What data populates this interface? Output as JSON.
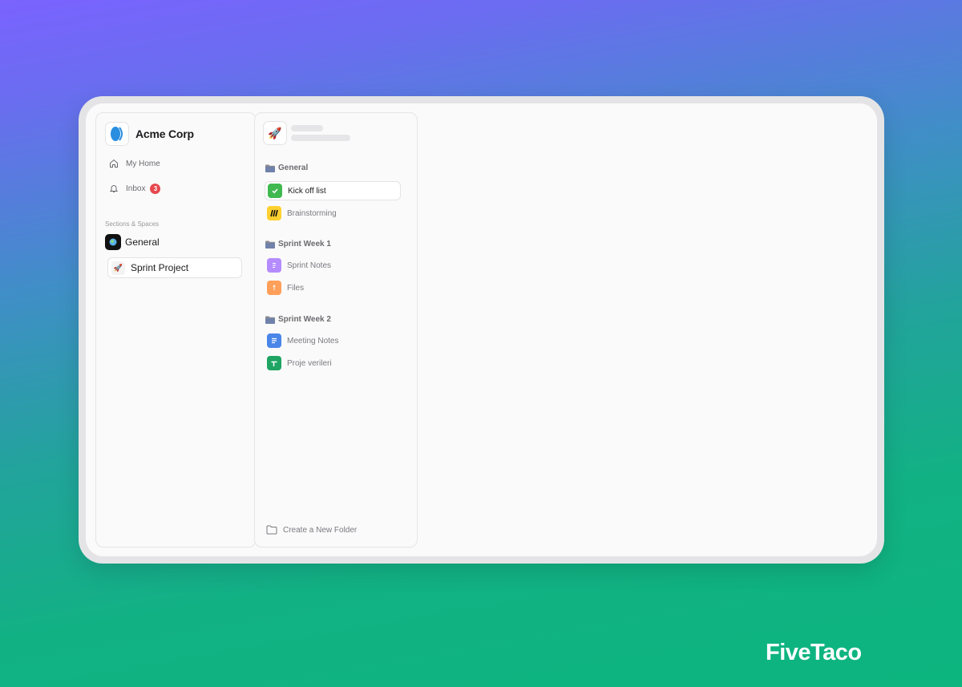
{
  "workspace": {
    "name": "Acme Corp"
  },
  "nav": [
    {
      "label": "My Home",
      "icon": "home-icon"
    },
    {
      "label": "Inbox",
      "icon": "bell-icon",
      "badge": "3"
    }
  ],
  "sections_label": "Sections & Spaces",
  "space": {
    "name": "General",
    "icon": "globe-icon"
  },
  "project": {
    "name": "Sprint Project",
    "icon": "rocket-icon"
  },
  "panel": {
    "header_icon": "rocket-icon",
    "folders": [
      {
        "name": "General",
        "items": [
          {
            "label": "Kick off list",
            "icon": "checkbox-icon",
            "color": "#3fb950",
            "active": true
          },
          {
            "label": "Brainstorming",
            "icon": "miro-icon",
            "color": "#ffd02f",
            "active": false
          }
        ]
      },
      {
        "name": "Sprint Week 1",
        "items": [
          {
            "label": "Sprint Notes",
            "icon": "notes-icon",
            "color": "#b58cff",
            "active": false
          },
          {
            "label": "Files",
            "icon": "file-icon",
            "color": "#ff9f59",
            "active": false
          }
        ]
      },
      {
        "name": "Sprint Week 2",
        "items": [
          {
            "label": "Meeting Notes",
            "icon": "google-docs-icon",
            "color": "#4a86e8",
            "active": false
          },
          {
            "label": "Proje verileri",
            "icon": "google-sheets-icon",
            "color": "#1fa463",
            "active": false
          }
        ]
      }
    ],
    "create_folder_label": "Create a New Folder"
  },
  "brand": "FiveTaco"
}
